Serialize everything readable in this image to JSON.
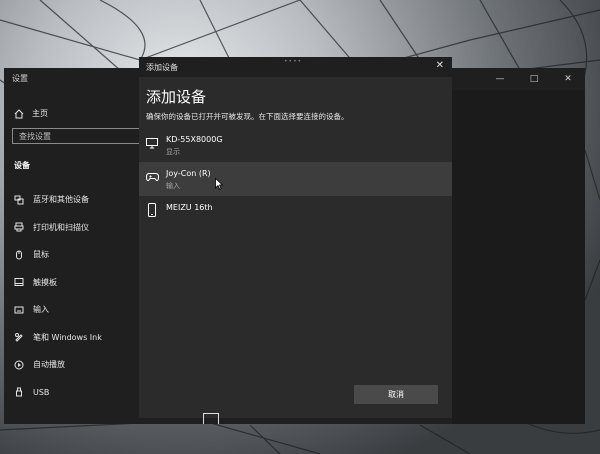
{
  "settings": {
    "title": "设置",
    "home_label": "主页",
    "search_placeholder": "查找设置",
    "section_title": "设备",
    "nav_items": [
      {
        "label": "蓝牙和其他设备",
        "icon": "bluetooth-devices-icon"
      },
      {
        "label": "打印机和扫描仪",
        "icon": "printer-icon"
      },
      {
        "label": "鼠标",
        "icon": "mouse-icon"
      },
      {
        "label": "触摸板",
        "icon": "touchpad-icon"
      },
      {
        "label": "输入",
        "icon": "keyboard-icon"
      },
      {
        "label": "笔和 Windows Ink",
        "icon": "pen-icon"
      },
      {
        "label": "自动播放",
        "icon": "autoplay-icon"
      },
      {
        "label": "USB",
        "icon": "usb-icon"
      }
    ]
  },
  "dialog": {
    "title": "添加设备",
    "heading": "添加设备",
    "description": "确保你的设备已打开并可被发现。在下面选择要连接的设备。",
    "devices": [
      {
        "name": "KD-55X8000G",
        "type": "显示",
        "icon": "monitor-icon"
      },
      {
        "name": "Joy-Con (R)",
        "type": "输入",
        "icon": "gamepad-icon"
      },
      {
        "name": "MEIZU 16th",
        "type": "",
        "icon": "phone-icon"
      }
    ],
    "cancel_label": "取消"
  }
}
